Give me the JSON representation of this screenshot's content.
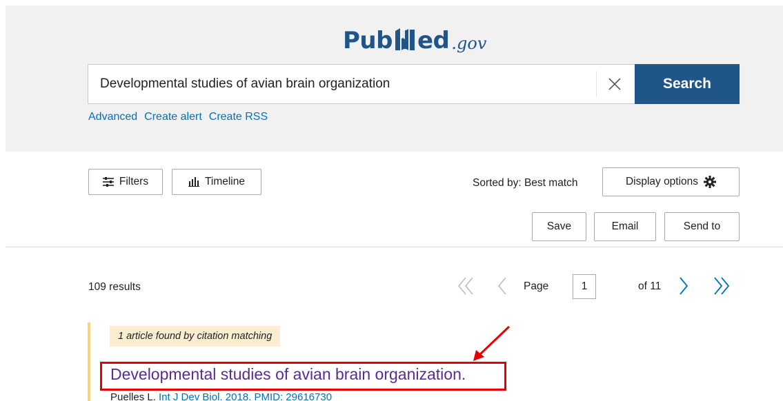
{
  "logo": {
    "pub": "Pub",
    "ed": "ed",
    "gov": ".gov"
  },
  "search": {
    "value": "Developmental studies of avian brain organization",
    "button_label": "Search"
  },
  "header_links": {
    "advanced": "Advanced",
    "create_alert": "Create alert",
    "create_rss": "Create RSS"
  },
  "toolbar": {
    "filters_label": "Filters",
    "timeline_label": "Timeline",
    "sorted_by": "Sorted by: Best match",
    "display_options_label": "Display options",
    "save_label": "Save",
    "email_label": "Email",
    "send_to_label": "Send to"
  },
  "results": {
    "count_text": "109 results",
    "page_label": "Page",
    "page_value": "1",
    "of_text": "of 11"
  },
  "result_item": {
    "badge_text": "1 article found by citation matching",
    "title": "Developmental studies of avian brain organization.",
    "author": "Puelles L.",
    "journal": "Int J Dev Biol.",
    "year_pmid": " 2018. PMID: 29616730"
  },
  "colors": {
    "brand": "#20558a",
    "link": "#0071bc",
    "visited_title": "#5a2a97",
    "annotation": "#e60000",
    "badge_bg": "#fbedd0"
  }
}
